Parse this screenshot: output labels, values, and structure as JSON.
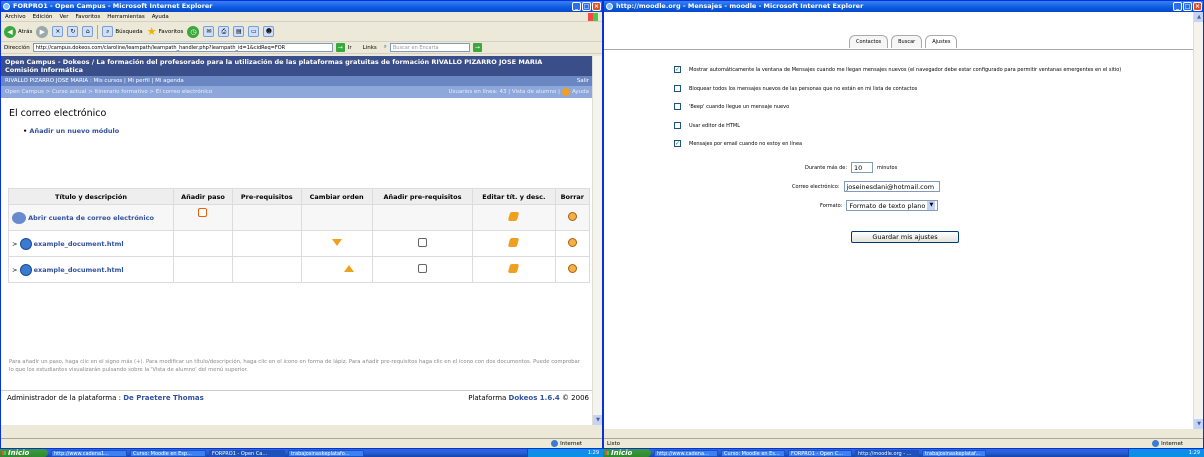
{
  "left_window": {
    "title": "FORPRO1 - Open Campus - Microsoft Internet Explorer",
    "menu": [
      "Archivo",
      "Edición",
      "Ver",
      "Favoritos",
      "Herramientas",
      "Ayuda"
    ],
    "toolbar": {
      "back": "Atrás",
      "search": "Búsqueda",
      "favorites": "Favoritos"
    },
    "address_label": "Dirección",
    "address": "http://campus.dokeos.com/claroline/learnpath/learnpath_handler.php?learnpath_id=1&cidReq=FOR",
    "go_label": "Ir",
    "links_label": "Links",
    "search_placeholder": "Buscar en Encarta",
    "page": {
      "header_line1": "Open Campus - Dokeos  /  La formación del profesorado para la utilización de las plataformas gratuitas de formación RIVALLO PIZARRO JOSE MARIA",
      "header_line2": "Comisión Informática",
      "user_bar": "RIVALLO PIZARRO JOSE MARIA : Mis cursos | Mi perfil | Mi agenda",
      "logout": "Salir",
      "breadcrumb": "Open Campus > Curso actual > Itinerario formativo > El correo electrónico",
      "online": "Usuarios en línea: 43 | Vista de alumno |",
      "help": "Ayuda",
      "title": "El correo electrónico",
      "add_module": "Añadir un nuevo módulo",
      "columns": [
        "Título y descripción",
        "Añadir paso",
        "Pre-requisitos",
        "Cambiar orden",
        "Añadir pre-requisitos",
        "Editar tít. y desc.",
        "Borrar"
      ],
      "rows": [
        {
          "expander": "",
          "title": "Abrir cuenta de correo electrónico"
        },
        {
          "expander": ">",
          "title": "example_document.html"
        },
        {
          "expander": ">",
          "title": "example_document.html"
        }
      ],
      "help_text": "Para añadir un paso, haga clic en el signo más (+). Para modificar un título/descripción, haga clic en el icono en forma de lápiz. Para añadir pre-requisitos haga clic en el icono con dos documentos. Puede comprobar lo que los estudiantes visualizarán pulsando sobre la 'Vista de alumno' del menú superior.",
      "footer_admin_label": "Administrador de la plataforma : ",
      "footer_admin_name": "De Praetere Thomas",
      "footer_platform_pre": "Plataforma ",
      "footer_platform_name": "Dokeos 1.6.4",
      "footer_platform_post": " © 2006"
    },
    "status": {
      "left": "",
      "zone": "Internet"
    }
  },
  "right_window": {
    "title": "http://moodle.org - Mensajes - moodle - Microsoft Internet Explorer",
    "tabs": [
      "Contactos",
      "Buscar",
      "Ajustes"
    ],
    "prefs": [
      {
        "checked": "✓",
        "label": "Mostrar automáticamente la ventana de Mensajes cuando me llegan mensajes nuevos (el navegador debe estar configurado para permitir ventanas emergentes en el sitio)"
      },
      {
        "checked": "",
        "label": "Bloquear todos los mensajes nuevos de las personas que no están en mi lista de contactos"
      },
      {
        "checked": "",
        "label": "'Beep' cuando llegue un mensaje nuevo"
      },
      {
        "checked": "",
        "label": "Usar editor de HTML"
      },
      {
        "checked": "✓",
        "label": "Mensajes por email cuando no estoy en línea"
      }
    ],
    "duration_label": "Durante más de:",
    "duration_value": "10",
    "duration_unit": "minutos",
    "email_label": "Correo electrónico:",
    "email_value": "joseinesdani@hotmail.com",
    "format_label": "Formato:",
    "format_value": "Formato de texto plano",
    "save_label": "Guardar mis ajustes",
    "status": {
      "left": "Listo",
      "zone": "Internet"
    }
  },
  "taskbar_left": {
    "start": "Inicio",
    "items": [
      "http://www.cadena1...",
      "Curso: Moodle en Esp...",
      "FORPRO1 - Open Ca...",
      "trabajosinaskeplatafo..."
    ],
    "time": "1:29"
  },
  "taskbar_right": {
    "start": "Inicio",
    "items": [
      "http://www.cadena...",
      "Curso: Moodle en Es...",
      "FORPRO1 - Open C...",
      "http://moodle.org - ...",
      "trabajosinaskeplataf..."
    ],
    "time": "1:29"
  }
}
